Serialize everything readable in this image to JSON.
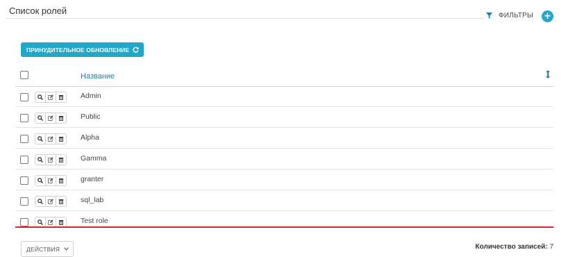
{
  "page": {
    "title": "Список ролей",
    "filters_label": "ФИЛЬТРЫ",
    "add_label": "+"
  },
  "toolbar": {
    "refresh_label": "ПРИНУДИТЕЛЬНОЕ ОБНОВЛЕНИЕ"
  },
  "table": {
    "columns": [
      "Название"
    ],
    "rows": [
      {
        "name": "Admin"
      },
      {
        "name": "Public"
      },
      {
        "name": "Alpha"
      },
      {
        "name": "Gamma"
      },
      {
        "name": "granter"
      },
      {
        "name": "sql_lab"
      },
      {
        "name": "Test role"
      }
    ]
  },
  "footer": {
    "actions_label": "ДЕЙСТВИЯ",
    "count_label": "Количество записей:",
    "count_value": "7"
  },
  "colors": {
    "accent": "#20a7c9",
    "header_link": "#1d7ea9",
    "highlight_line": "#d9262c"
  },
  "icons": {
    "filter": "funnel-icon",
    "add": "plus-icon",
    "refresh": "refresh-icon",
    "sort": "sort-arrows-icon",
    "row_actions": [
      "search-icon",
      "edit-icon",
      "trash-icon"
    ],
    "dropdown": "chevron-down-icon"
  }
}
